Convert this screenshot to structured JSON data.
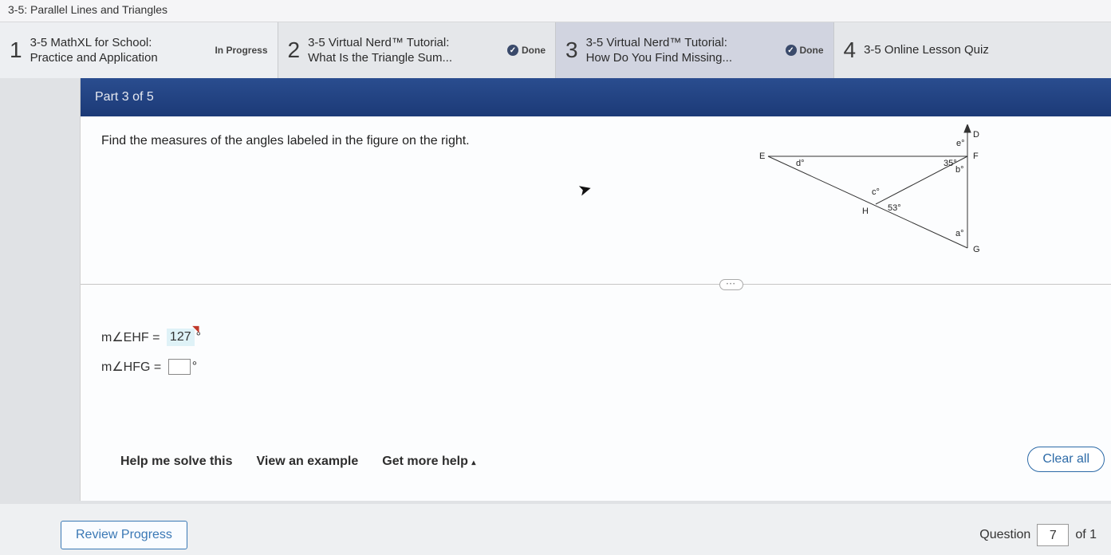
{
  "breadcrumb": "3-5: Parallel Lines and Triangles",
  "tabs": [
    {
      "num": "1",
      "title": "3-5 MathXL for School:",
      "sub": "Practice and Application",
      "status": "In Progress"
    },
    {
      "num": "2",
      "title": "3-5 Virtual Nerd™ Tutorial:",
      "sub": "What Is the Triangle Sum...",
      "status": "Done"
    },
    {
      "num": "3",
      "title": "3-5 Virtual Nerd™ Tutorial:",
      "sub": "How Do You Find Missing...",
      "status": "Done"
    },
    {
      "num": "4",
      "title": "3-5 Online Lesson Quiz",
      "sub": "",
      "status": ""
    }
  ],
  "part_label": "Part 3 of 5",
  "prompt": "Find the measures of the angles labeled in the figure on the right.",
  "figure": {
    "points": [
      "D",
      "E",
      "F",
      "G",
      "H"
    ],
    "angle_labels": {
      "a": "a°",
      "b": "b°",
      "c": "c°",
      "d": "d°",
      "e": "e°"
    },
    "known_angles": {
      "EFH": "35°",
      "EHG": "53°"
    }
  },
  "answers": {
    "line1": {
      "lhs": "m∠EHF =",
      "value": "127",
      "unit": "°"
    },
    "line2": {
      "lhs": "m∠HFG =",
      "value": "",
      "unit": "°"
    }
  },
  "help": {
    "solve": "Help me solve this",
    "example": "View an example",
    "more": "Get more help",
    "caret": "▴"
  },
  "clear_all": "Clear all",
  "review": "Review Progress",
  "question": {
    "label": "Question",
    "num": "7",
    "of": "of 1"
  }
}
